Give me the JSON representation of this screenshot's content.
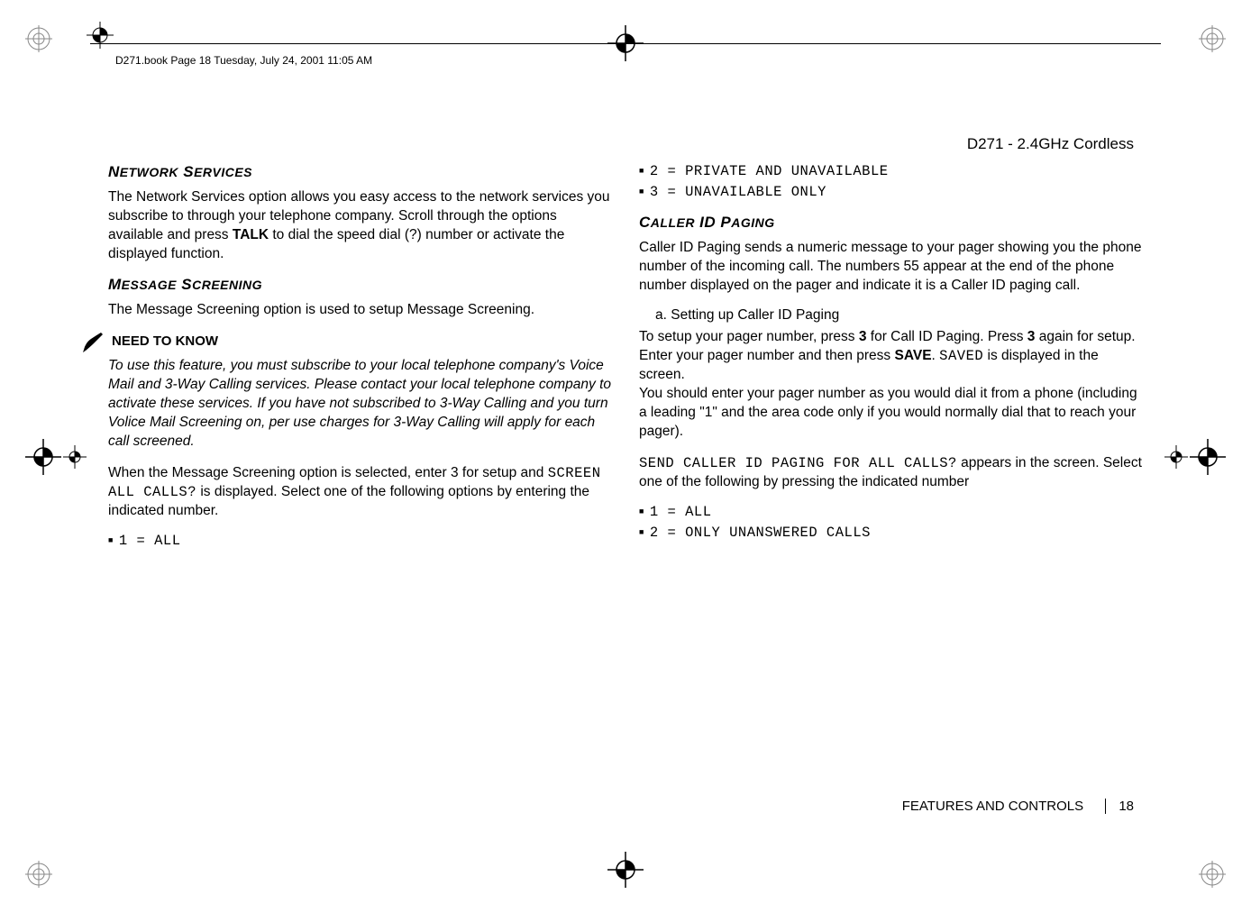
{
  "header": {
    "file_info": "D271.book  Page 18  Tuesday, July 24, 2001  11:05 AM",
    "product_title": "D271 - 2.4GHz Cordless"
  },
  "left_column": {
    "section1": {
      "heading_main": "N",
      "heading_rest": "ETWORK",
      "heading_main2": " S",
      "heading_rest2": "ERVICES",
      "body": "The Network Services option allows you easy access to the network services you subscribe to through your telephone company. Scroll through the options available and press ",
      "body_bold1": "TALK",
      "body_after": " to dial the speed dial (?) number or activate the displayed function."
    },
    "section2": {
      "heading_main": "M",
      "heading_rest": "ESSAGE",
      "heading_main2": " S",
      "heading_rest2": "CREENING",
      "body": "The Message Screening option is used to setup Message Screening."
    },
    "need_to_know": {
      "label": "NEED TO KNOW",
      "text": "To use this feature, you must subscribe to your local telephone company's Voice Mail and 3-Way Calling services. Please contact your local telephone company to activate these services. If you have not subscribed to 3-Way Calling and you turn Volice Mail Screening on, per use charges for 3-Way Calling will apply for each call screened."
    },
    "section3": {
      "body_before": "When the Message Screening option is selected, enter 3 for setup and ",
      "lcd": "SCREEN ALL CALLS?",
      "body_after": " is displayed. Select one of the following options by entering the indicated number."
    },
    "list1": {
      "item1": "1 = ALL"
    }
  },
  "right_column": {
    "list_top": {
      "item1": "2 = PRIVATE AND UNAVAILABLE",
      "item2": "3 = UNAVAILABLE ONLY"
    },
    "section1": {
      "heading_main": "C",
      "heading_rest": "ALLER",
      "heading_main2": " ID P",
      "heading_rest2": "AGING",
      "body": "Caller ID Paging sends a numeric message to your pager showing you the phone number of the incoming call. The numbers 55 appear at the end of the phone number displayed on the pager and indicate it is a Caller ID paging call."
    },
    "sub_a": {
      "label": "a.  Setting up Caller ID Paging"
    },
    "para2": {
      "text1": "To setup your pager number, press ",
      "bold1": "3",
      "text2": " for Call ID Paging. Press ",
      "bold2": "3",
      "text3": " again for setup. Enter your pager number and then press ",
      "bold3": "SAVE",
      "text4": ". ",
      "lcd1": "SAVED",
      "text5": " is displayed in the screen."
    },
    "para3": "You should enter your pager number as you would dial it from a phone (including a leading \"1\" and the area code only if you would normally dial that to reach your pager).",
    "para4": {
      "lcd": "SEND CALLER ID PAGING FOR ALL CALLS?",
      "text": " appears in the screen. Select one of the following by pressing the indicated number"
    },
    "list2": {
      "item1": "1 = ALL",
      "item2": "2 = ONLY UNANSWERED CALLS"
    }
  },
  "footer": {
    "section": "FEATURES AND CONTROLS",
    "page": "18"
  }
}
